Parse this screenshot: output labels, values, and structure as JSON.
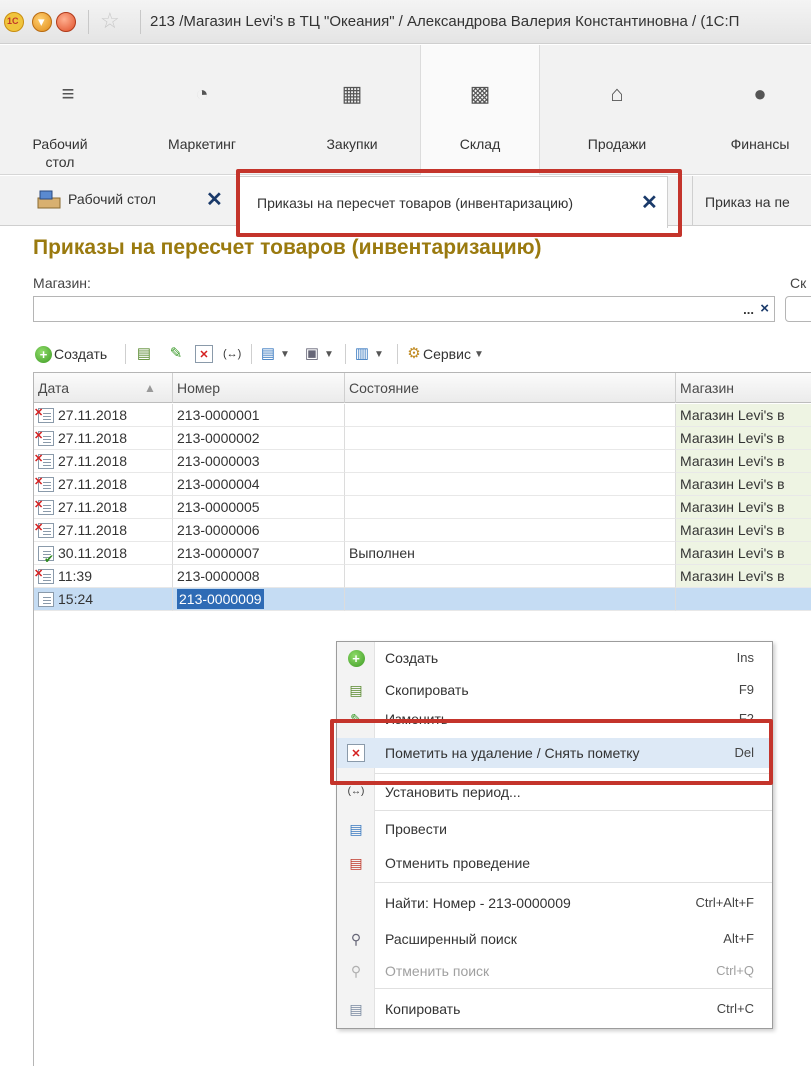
{
  "window": {
    "title": "213 /Магазин Levi's в ТЦ \"Океания\" / Александрова Валерия Константиновна / (1С:П"
  },
  "sections": [
    {
      "label": "Рабочий стол",
      "icon": "menu-lines-icon"
    },
    {
      "label": "Маркетинг",
      "icon": "pie-chart-icon"
    },
    {
      "label": "Закупки",
      "icon": "cart-icon"
    },
    {
      "label": "Склад",
      "icon": "warehouse-icon"
    },
    {
      "label": "Продажи",
      "icon": "basket-icon"
    },
    {
      "label": "Финансы",
      "icon": "ruble-icon"
    }
  ],
  "tabs": [
    {
      "label": "Рабочий стол"
    },
    {
      "label": "Приказы на пересчет товаров (инвентаризацию)"
    },
    {
      "label": "Приказ на пе"
    }
  ],
  "page": {
    "title": "Приказы на пересчет товаров (инвентаризацию)",
    "store_label": "Магазин:",
    "store_value": "",
    "sk_label": "Ск",
    "field_dots": "...",
    "field_clear": "×"
  },
  "toolbar": {
    "create_label": "Создать",
    "service_label": "Сервис"
  },
  "table": {
    "columns": [
      "Дата",
      "Номер",
      "Состояние",
      "Магазин"
    ],
    "rows": [
      {
        "date": "27.11.2018",
        "number": "213-0000001",
        "state": "",
        "store": "Магазин Levi's в",
        "status": "deleted"
      },
      {
        "date": "27.11.2018",
        "number": "213-0000002",
        "state": "",
        "store": "Магазин Levi's в",
        "status": "deleted"
      },
      {
        "date": "27.11.2018",
        "number": "213-0000003",
        "state": "",
        "store": "Магазин Levi's в",
        "status": "deleted"
      },
      {
        "date": "27.11.2018",
        "number": "213-0000004",
        "state": "",
        "store": "Магазин Levi's в",
        "status": "deleted"
      },
      {
        "date": "27.11.2018",
        "number": "213-0000005",
        "state": "",
        "store": "Магазин Levi's в",
        "status": "deleted"
      },
      {
        "date": "27.11.2018",
        "number": "213-0000006",
        "state": "",
        "store": "Магазин Levi's в",
        "status": "deleted"
      },
      {
        "date": "30.11.2018",
        "number": "213-0000007",
        "state": "Выполнен",
        "store": "Магазин Levi's в",
        "status": "posted"
      },
      {
        "date": "11:39",
        "number": "213-0000008",
        "state": "",
        "store": "Магазин Levi's в",
        "status": "deleted"
      },
      {
        "date": "15:24",
        "number": "213-0000009",
        "state": "",
        "store": "",
        "status": "normal"
      }
    ]
  },
  "context_menu": {
    "items": [
      {
        "label": "Создать",
        "shortcut": "Ins",
        "icon": "green-plus-icon"
      },
      {
        "label": "Скопировать",
        "shortcut": "F9",
        "icon": "copy-doc-icon"
      },
      {
        "label": "Изменить",
        "shortcut": "F2",
        "icon": "pencil-icon"
      },
      {
        "label": "Пометить на удаление / Снять пометку",
        "shortcut": "Del",
        "icon": "delete-mark-icon"
      },
      {
        "label": "Установить период...",
        "shortcut": "",
        "icon": "period-icon"
      },
      {
        "label": "Провести",
        "shortcut": "",
        "icon": "post-doc-icon"
      },
      {
        "label": "Отменить проведение",
        "shortcut": "",
        "icon": "unpost-doc-icon"
      },
      {
        "label": "Найти: Номер - 213-0000009",
        "shortcut": "Ctrl+Alt+F",
        "icon": ""
      },
      {
        "label": "Расширенный поиск",
        "shortcut": "Alt+F",
        "icon": "magnifier-icon"
      },
      {
        "label": "Отменить поиск",
        "shortcut": "Ctrl+Q",
        "icon": "cancel-search-icon"
      },
      {
        "label": "Копировать",
        "shortcut": "Ctrl+C",
        "icon": "copy-icon"
      }
    ]
  },
  "colors": {
    "title_gold": "#9a7a0f",
    "highlight_red": "#c4342b",
    "selection_blue": "#2e6bb5"
  }
}
